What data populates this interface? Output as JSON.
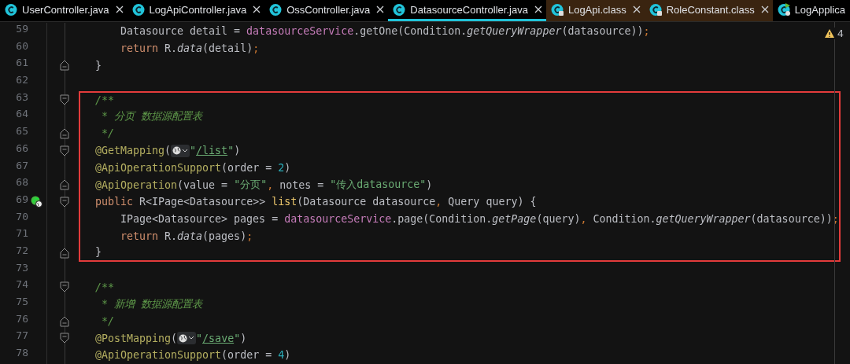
{
  "tabs": [
    {
      "label": "UserController.java",
      "kind": "java",
      "selected": false
    },
    {
      "label": "LogApiController.java",
      "kind": "java",
      "selected": false
    },
    {
      "label": "OssController.java",
      "kind": "java",
      "selected": false
    },
    {
      "label": "DatasourceController.java",
      "kind": "java",
      "selected": true
    },
    {
      "label": "LogApi.class",
      "kind": "class",
      "selected": false
    },
    {
      "label": "RoleConstant.class",
      "kind": "class",
      "selected": false
    },
    {
      "label": "LogApplica",
      "kind": "app",
      "selected": false
    }
  ],
  "inspections": {
    "warnings": "4"
  },
  "lines": [
    {
      "number": "59",
      "kind": "plain",
      "nested": true,
      "highlighted": false,
      "tokens": [
        {
          "kind": "plain",
          "text": "Datasource detail = "
        },
        {
          "kind": "field",
          "text": "datasourceService"
        },
        {
          "kind": "plain",
          "text": ".getOne(Condition."
        },
        {
          "kind": "call",
          "text": "getQueryWrapper"
        },
        {
          "kind": "plain",
          "text": "(datasource))"
        },
        {
          "kind": "punct",
          "text": ";"
        }
      ]
    },
    {
      "number": "60",
      "kind": "plain",
      "nested": true,
      "highlighted": false,
      "tokens": [
        {
          "kind": "keyword",
          "text": "return "
        },
        {
          "kind": "plain",
          "text": "R."
        },
        {
          "kind": "call",
          "text": "data"
        },
        {
          "kind": "plain",
          "text": "(detail)"
        },
        {
          "kind": "punct",
          "text": ";"
        }
      ]
    },
    {
      "number": "61",
      "kind": "fold-end",
      "nested": false,
      "highlighted": false,
      "tokens": [
        {
          "kind": "plain",
          "text": "}"
        }
      ]
    },
    {
      "number": "62",
      "kind": "plain",
      "highlighted": false
    },
    {
      "number": "63",
      "kind": "fold-start",
      "nested": false,
      "highlighted": true,
      "tokens": [
        {
          "kind": "comment",
          "text": "/**"
        }
      ]
    },
    {
      "number": "64",
      "kind": "plain",
      "nested": false,
      "highlighted": true,
      "tokens": [
        {
          "kind": "comment",
          "text": " * 分页 数据源配置表"
        }
      ]
    },
    {
      "number": "65",
      "kind": "fold-end",
      "nested": false,
      "highlighted": true,
      "tokens": [
        {
          "kind": "comment",
          "text": " */"
        }
      ]
    },
    {
      "number": "66",
      "kind": "fold-start",
      "nested": false,
      "highlighted": true,
      "tokens": [
        {
          "kind": "annotation",
          "text": "@GetMapping"
        },
        {
          "kind": "plain",
          "text": "("
        },
        {
          "kind": "route"
        },
        {
          "kind": "string",
          "text": "\""
        },
        {
          "kind": "link",
          "text": "/list"
        },
        {
          "kind": "string",
          "text": "\""
        },
        {
          "kind": "plain",
          "text": ")"
        }
      ]
    },
    {
      "number": "67",
      "kind": "plain",
      "nested": false,
      "highlighted": true,
      "tokens": [
        {
          "kind": "annotation",
          "text": "@ApiOperationSupport"
        },
        {
          "kind": "plain",
          "text": "(order = "
        },
        {
          "kind": "number",
          "text": "2"
        },
        {
          "kind": "plain",
          "text": ")"
        }
      ]
    },
    {
      "number": "68",
      "kind": "fold-end",
      "nested": false,
      "highlighted": true,
      "tokens": [
        {
          "kind": "annotation",
          "text": "@ApiOperation"
        },
        {
          "kind": "plain",
          "text": "(value = "
        },
        {
          "kind": "string",
          "text": "\"分页\""
        },
        {
          "kind": "punct",
          "text": ", "
        },
        {
          "kind": "plain",
          "text": "notes = "
        },
        {
          "kind": "string",
          "text": "\"传入datasource\""
        },
        {
          "kind": "plain",
          "text": ")"
        }
      ]
    },
    {
      "number": "69",
      "kind": "fold-start",
      "nested": false,
      "gutter": {
        "kind": "endpoint"
      },
      "highlighted": true,
      "tokens": [
        {
          "kind": "keyword",
          "text": "public "
        },
        {
          "kind": "plain",
          "text": "R<IPage<Datasource>> "
        },
        {
          "kind": "method",
          "text": "list"
        },
        {
          "kind": "plain",
          "text": "(Datasource datasource"
        },
        {
          "kind": "punct",
          "text": ", "
        },
        {
          "kind": "plain",
          "text": "Query query) {"
        }
      ]
    },
    {
      "number": "70",
      "kind": "plain",
      "nested": true,
      "highlighted": true,
      "tokens": [
        {
          "kind": "plain",
          "text": "IPage<Datasource> pages = "
        },
        {
          "kind": "field",
          "text": "datasourceService"
        },
        {
          "kind": "plain",
          "text": ".page(Condition."
        },
        {
          "kind": "call",
          "text": "getPage"
        },
        {
          "kind": "plain",
          "text": "(query)"
        },
        {
          "kind": "punct",
          "text": ", "
        },
        {
          "kind": "plain",
          "text": "Condition."
        },
        {
          "kind": "call",
          "text": "getQueryWrapper"
        },
        {
          "kind": "plain",
          "text": "(datasource))"
        },
        {
          "kind": "punct",
          "text": ";"
        }
      ]
    },
    {
      "number": "71",
      "kind": "plain",
      "nested": true,
      "highlighted": true,
      "tokens": [
        {
          "kind": "keyword",
          "text": "return "
        },
        {
          "kind": "plain",
          "text": "R."
        },
        {
          "kind": "call",
          "text": "data"
        },
        {
          "kind": "plain",
          "text": "(pages)"
        },
        {
          "kind": "punct",
          "text": ";"
        }
      ]
    },
    {
      "number": "72",
      "kind": "fold-end",
      "nested": false,
      "highlighted": true,
      "tokens": [
        {
          "kind": "plain",
          "text": "}"
        }
      ]
    },
    {
      "number": "73",
      "kind": "plain",
      "highlighted": false
    },
    {
      "number": "74",
      "kind": "fold-start",
      "nested": false,
      "highlighted": false,
      "tokens": [
        {
          "kind": "comment",
          "text": "/**"
        }
      ]
    },
    {
      "number": "75",
      "kind": "plain",
      "nested": false,
      "highlighted": false,
      "tokens": [
        {
          "kind": "comment",
          "text": " * 新增 数据源配置表"
        }
      ]
    },
    {
      "number": "76",
      "kind": "fold-end",
      "nested": false,
      "highlighted": false,
      "tokens": [
        {
          "kind": "comment",
          "text": " */"
        }
      ]
    },
    {
      "number": "77",
      "kind": "fold-start",
      "nested": false,
      "highlighted": false,
      "tokens": [
        {
          "kind": "annotation",
          "text": "@PostMapping"
        },
        {
          "kind": "plain",
          "text": "("
        },
        {
          "kind": "route"
        },
        {
          "kind": "string",
          "text": "\""
        },
        {
          "kind": "link",
          "text": "/save"
        },
        {
          "kind": "string",
          "text": "\""
        },
        {
          "kind": "plain",
          "text": ")"
        }
      ]
    },
    {
      "number": "78",
      "kind": "plain",
      "nested": false,
      "highlighted": false,
      "tokens": [
        {
          "kind": "annotation",
          "text": "@ApiOperationSupport"
        },
        {
          "kind": "plain",
          "text": "(order = "
        },
        {
          "kind": "number",
          "text": "4"
        },
        {
          "kind": "plain",
          "text": ")"
        }
      ]
    }
  ]
}
